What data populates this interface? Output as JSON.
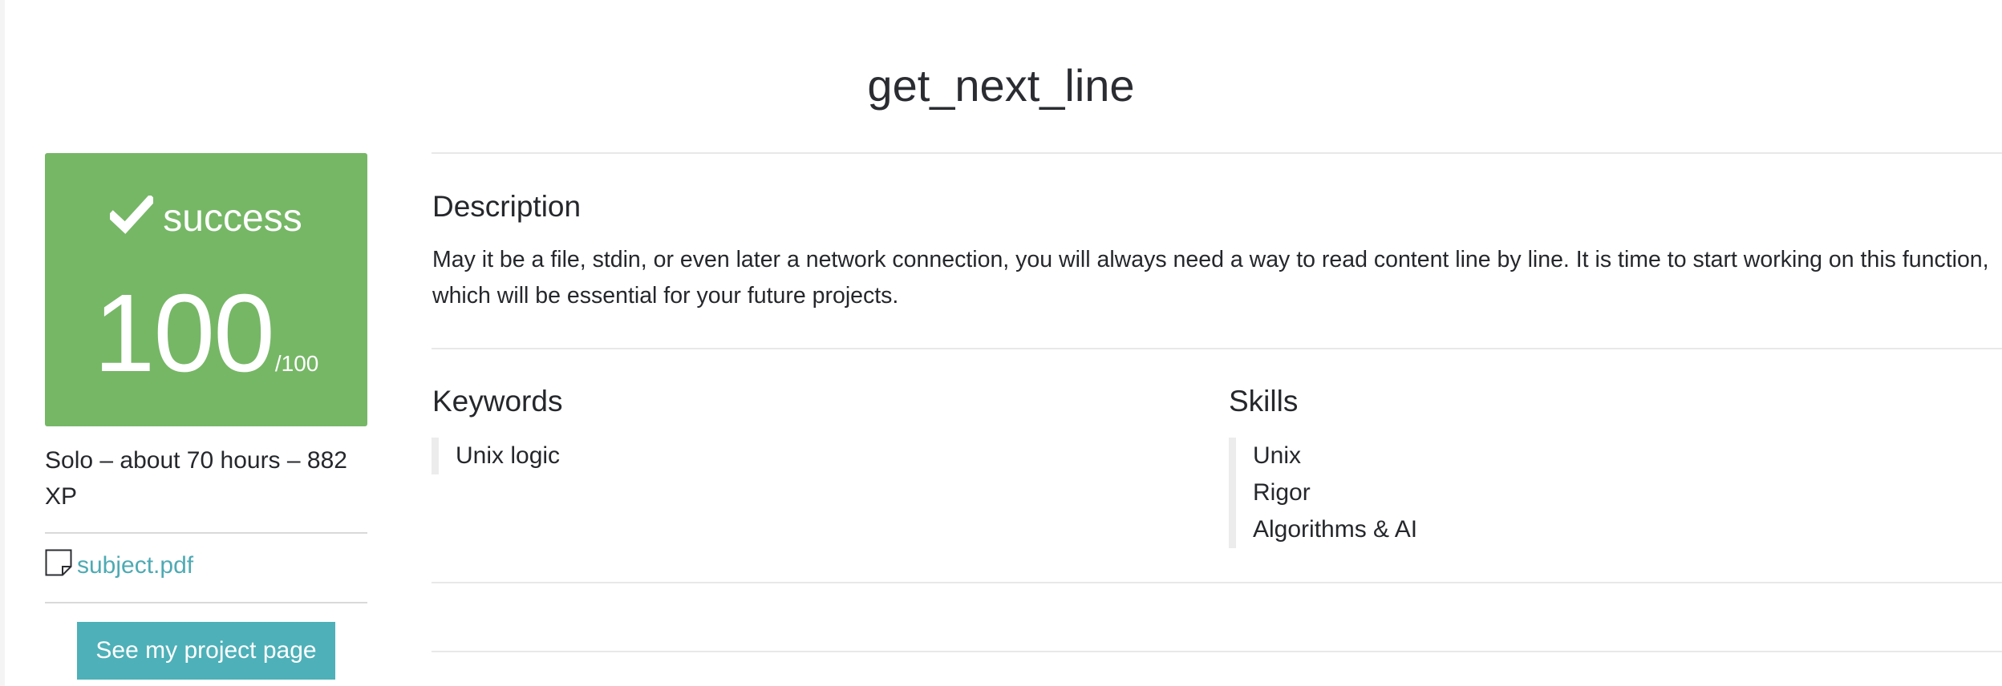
{
  "project": {
    "title": "get_next_line"
  },
  "score_card": {
    "status": "success",
    "status_icon": "checkmark-icon",
    "score": "100",
    "score_max": "/100",
    "color": "#76b766"
  },
  "meta": {
    "info": "Solo – about 70 hours – 882 XP"
  },
  "subject": {
    "icon": "document-icon",
    "label": "subject.pdf",
    "color": "#4eaab3"
  },
  "actions": {
    "project_page_label": "See my project page",
    "color": "#4eb0b8"
  },
  "description": {
    "heading": "Description",
    "text": "May it be a file, stdin, or even later a network connection, you will always need a way to read content line by line. It is time to start working on this function, which will be essential for your future projects."
  },
  "keywords": {
    "heading": "Keywords",
    "items": [
      "Unix logic"
    ]
  },
  "skills": {
    "heading": "Skills",
    "items": [
      "Unix",
      "Rigor",
      "Algorithms & AI"
    ]
  }
}
